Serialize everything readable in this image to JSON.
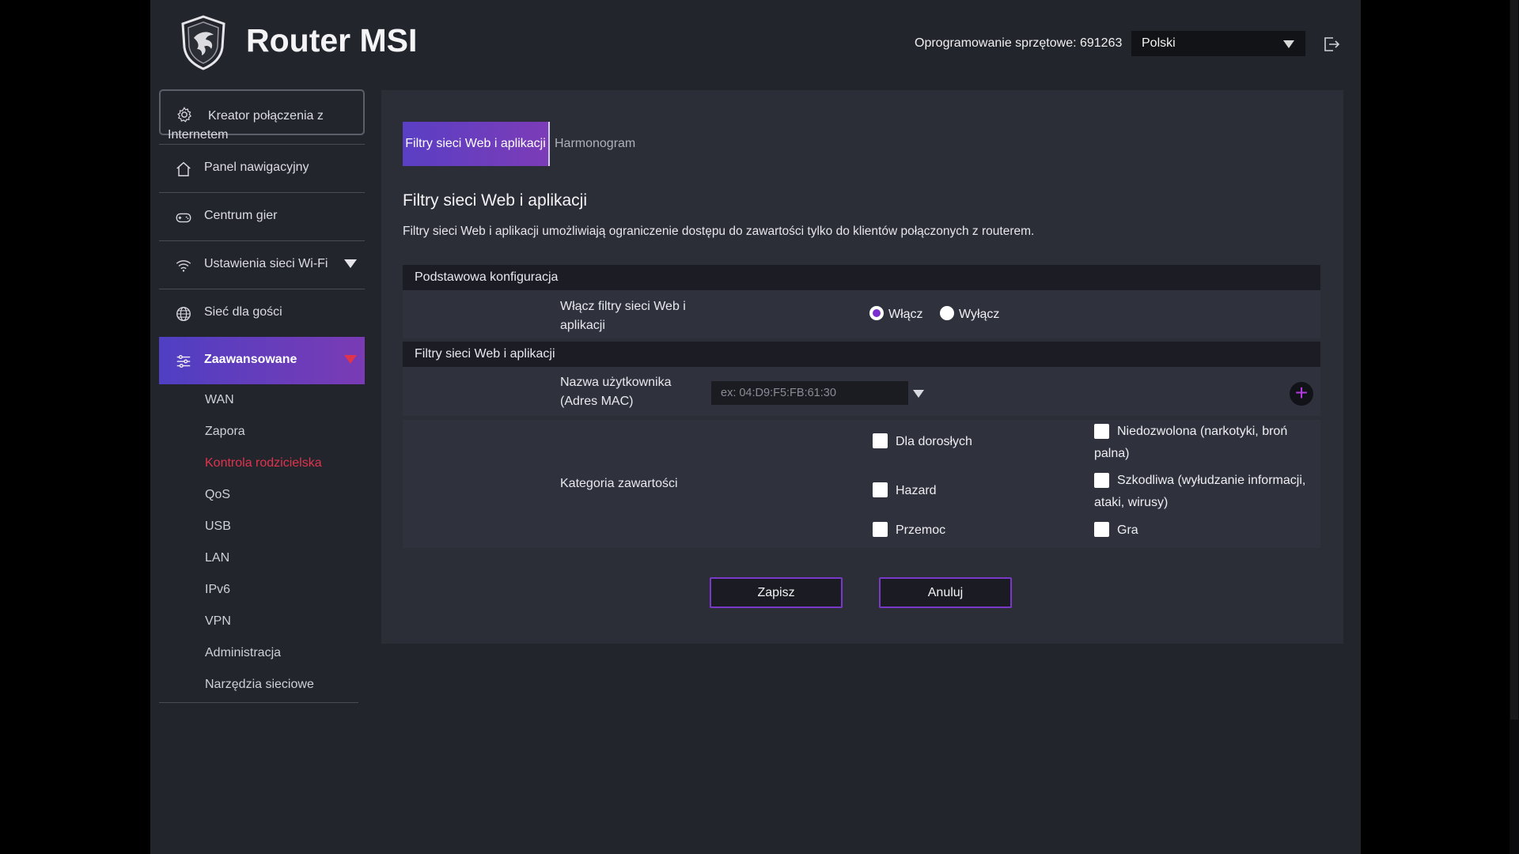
{
  "header": {
    "brand": "Router MSI",
    "firmware_label": "Oprogramowanie sprzętowe: 691263",
    "language": "Polski",
    "logout_icon": "logout-icon",
    "logo_icon": "msi-dragon-shield-logo"
  },
  "sidebar": {
    "wizard": {
      "label": "Kreator połączenia z Internetem",
      "icon": "gear-icon"
    },
    "items": [
      {
        "label": "Panel nawigacyjny",
        "icon": "home-icon"
      },
      {
        "label": "Centrum gier",
        "icon": "gamepad-icon"
      },
      {
        "label": "Ustawienia sieci Wi-Fi",
        "icon": "wifi-icon"
      },
      {
        "label": "Sieć dla gości",
        "icon": "globe-icon"
      },
      {
        "label": "Zaawansowane",
        "icon": "sliders-icon"
      }
    ],
    "sub_items": [
      {
        "label": "WAN"
      },
      {
        "label": "Zapora"
      },
      {
        "label": "Kontrola rodzicielska"
      },
      {
        "label": "QoS"
      },
      {
        "label": "USB"
      },
      {
        "label": "LAN"
      },
      {
        "label": "IPv6"
      },
      {
        "label": "VPN"
      },
      {
        "label": "Administracja"
      },
      {
        "label": "Narzędzia sieciowe"
      }
    ],
    "active_sub": "Kontrola rodzicielska"
  },
  "tabs": [
    {
      "label": "Filtry sieci Web i aplikacji",
      "active": true
    },
    {
      "label": "Harmonogram",
      "active": false
    }
  ],
  "main": {
    "title": "Filtry sieci Web i aplikacji",
    "description": "Filtry sieci Web i aplikacji umożliwiają ograniczenie dostępu do zawartości tylko do klientów połączonych z routerem.",
    "basic_section": "Podstawowa konfiguracja",
    "enable_label": "Włącz filtry sieci Web i aplikacji",
    "radio_on": "Włącz",
    "radio_off": "Wyłącz",
    "radio_value": "Włącz",
    "filters_section": "Filtry sieci Web i aplikacji",
    "user_label": "Nazwa użytkownika (Adres MAC)",
    "mac_placeholder": "ex: 04:D9:F5:FB:61:30",
    "category_label": "Kategoria zawartości",
    "categories": [
      {
        "label": "Dla dorosłych",
        "checked": false
      },
      {
        "label": "Niedozwolona (narkotyki, broń palna)",
        "checked": false
      },
      {
        "label": "Hazard",
        "checked": false
      },
      {
        "label": "Szkodliwa (wyłudzanie informacji, ataki, wirusy)",
        "checked": false
      },
      {
        "label": "Przemoc",
        "checked": false
      },
      {
        "label": "Gra",
        "checked": false
      }
    ],
    "save_label": "Zapisz",
    "cancel_label": "Anuluj"
  },
  "colors": {
    "accent_gradient_start": "#4f3fc2",
    "accent_gradient_end": "#7c3cb7",
    "active_link": "#e0334c",
    "add_icon": "#b33be0"
  }
}
